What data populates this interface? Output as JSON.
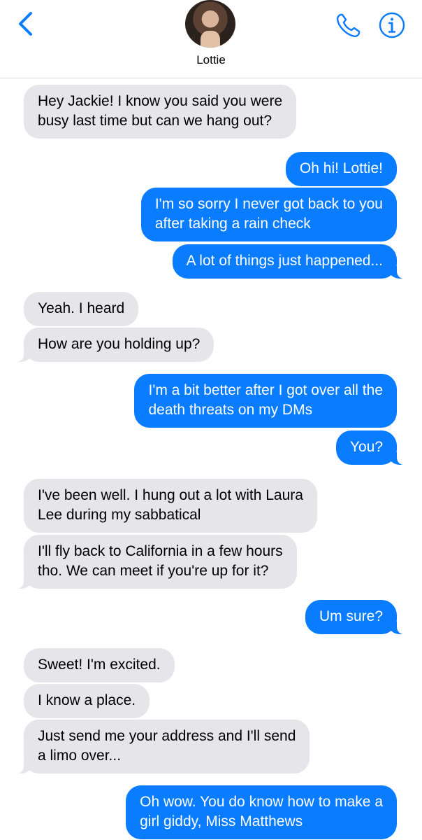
{
  "header": {
    "contact_name": "Lottie",
    "accent_color": "#0a7cff",
    "back_icon": "chevron-left-icon",
    "call_icon": "phone-icon",
    "info_icon": "info-icon"
  },
  "messages": [
    {
      "from": "contact",
      "lines": [
        "Hey Jackie! I know you said you were",
        "busy last time but can we hang out?"
      ]
    },
    {
      "from": "me",
      "lines": [
        "Oh hi! Lottie!"
      ]
    },
    {
      "from": "me",
      "lines": [
        "I'm so sorry I never got back to you",
        "after taking a rain check"
      ]
    },
    {
      "from": "me",
      "lines": [
        "A lot of things just happened..."
      ]
    },
    {
      "from": "contact",
      "lines": [
        "Yeah. I heard"
      ]
    },
    {
      "from": "contact",
      "lines": [
        "How are you holding up?"
      ]
    },
    {
      "from": "me",
      "lines": [
        "I'm a bit better after I got over all the",
        "death threats on my DMs"
      ]
    },
    {
      "from": "me",
      "lines": [
        "You?"
      ]
    },
    {
      "from": "contact",
      "lines": [
        "I've been well. I hung out a lot with Laura",
        "Lee during my sabbatical"
      ]
    },
    {
      "from": "contact",
      "lines": [
        "I'll fly back to California in a few hours",
        "tho. We can meet if you're up for it?"
      ]
    },
    {
      "from": "me",
      "lines": [
        "Um sure?"
      ]
    },
    {
      "from": "contact",
      "lines": [
        "Sweet! I'm excited."
      ]
    },
    {
      "from": "contact",
      "lines": [
        "I know a place."
      ]
    },
    {
      "from": "contact",
      "lines": [
        "Just send me your address and I'll send",
        "a limo over..."
      ]
    },
    {
      "from": "me",
      "lines": [
        "Oh wow. You do know how to make a",
        "girl giddy, Miss Matthews"
      ]
    }
  ]
}
